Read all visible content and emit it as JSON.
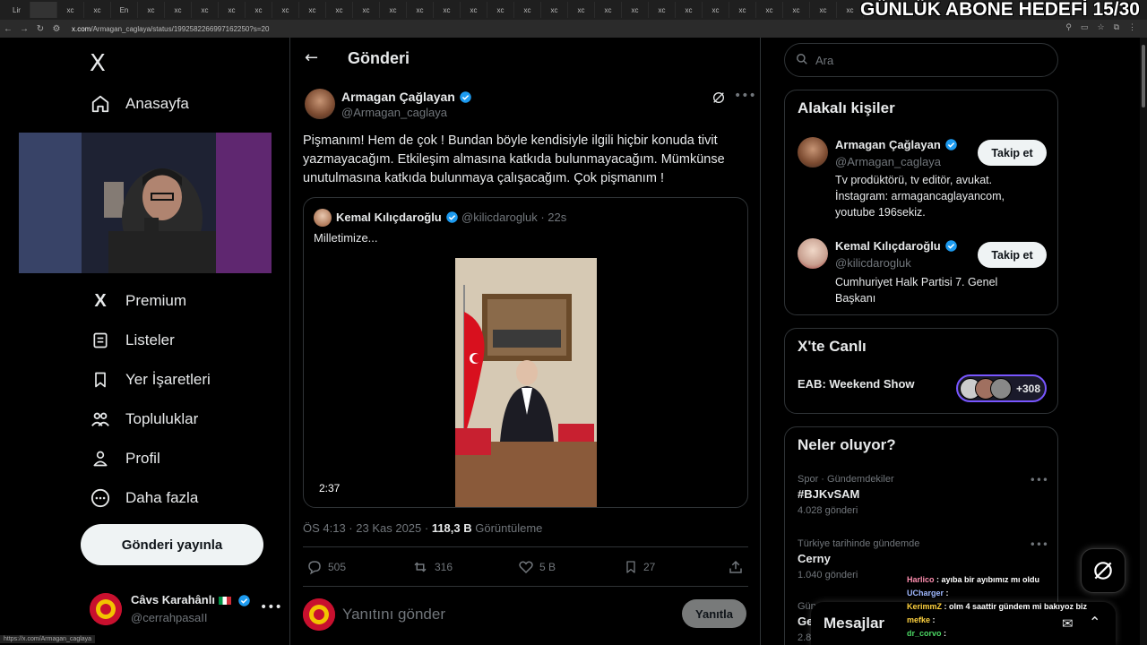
{
  "overlay": {
    "goal": "GÜNLÜK ABONE HEDEFİ 15/30"
  },
  "browser": {
    "tabs": [
      "Lir",
      "",
      "xc",
      "xc",
      "En",
      "xc",
      "xc",
      "xc",
      "xc",
      "xc",
      "xc",
      "xc",
      "xc",
      "xc",
      "xc",
      "xc",
      "xc",
      "xc",
      "xc",
      "xc",
      "xc",
      "xc",
      "xc",
      "xc",
      "xc",
      "xc",
      "xc",
      "xc",
      "xc",
      "xc",
      "xc",
      "xc"
    ],
    "url_host": "x.com",
    "url_path": "/Armagan_caglaya/status/1992582266997162250?s=20",
    "status_url": "https://x.com/Armagan_caglaya"
  },
  "sidebar": {
    "logo": "X",
    "items": [
      {
        "label": "Anasayfa",
        "icon": "home-icon"
      },
      {
        "label": "Premium",
        "icon": "x-premium-icon"
      },
      {
        "label": "Listeler",
        "icon": "list-icon"
      },
      {
        "label": "Yer İşaretleri",
        "icon": "bookmark-icon"
      },
      {
        "label": "Topluluklar",
        "icon": "communities-icon"
      },
      {
        "label": "Profil",
        "icon": "profile-icon"
      },
      {
        "label": "Daha fazla",
        "icon": "more-circle-icon"
      }
    ],
    "post_button": "Gönderi yayınla",
    "account": {
      "name": "Câvs Karahânlı",
      "handle": "@cerrahpasaII"
    }
  },
  "main": {
    "header_title": "Gönderi",
    "tweet": {
      "author": "Armagan Çağlayan",
      "handle": "@Armagan_caglaya",
      "text": "Pişmanım! Hem de çok ! Bundan böyle kendisiyle ilgili hiçbir konuda tivit yazmayacağım. Etkileşim almasına katkıda bulunmayacağım. Mümkünse unutulmasına katkıda bulunmaya çalışacağım. Çok pişmanım !",
      "quote": {
        "author": "Kemal Kılıçdaroğlu",
        "handle": "@kilicdarogluk",
        "time": "· 22s",
        "text": "Milletimize...",
        "video_duration": "2:37"
      },
      "time": "ÖS 4:13 · 23 Kas 2025 · ",
      "views_count": "118,3 B",
      "views_label": "Görüntüleme",
      "replies": "505",
      "reposts": "316",
      "likes": "5 B",
      "bookmarks": "27"
    },
    "reply_placeholder": "Yanıtını gönder",
    "reply_button": "Yanıtla"
  },
  "right": {
    "search_placeholder": "Ara",
    "related": {
      "title": "Alakalı kişiler",
      "people": [
        {
          "name": "Armagan Çağlayan",
          "handle": "@Armagan_caglaya",
          "bio": "Tv prodüktörü, tv editör, avukat. İnstagram: armagancaglayancom, youtube 196sekiz.",
          "follow": "Takip et"
        },
        {
          "name": "Kemal Kılıçdaroğlu",
          "handle": "@kilicdarogluk",
          "bio": "Cumhuriyet Halk Partisi 7. Genel Başkanı",
          "follow": "Takip et"
        }
      ]
    },
    "live": {
      "title": "X'te Canlı",
      "show": "EAB: Weekend Show",
      "count": "+308"
    },
    "trends": {
      "title": "Neler oluyor?",
      "items": [
        {
          "category": "Spor · Gündemdekiler",
          "name": "#BJKvSAM",
          "count": "4.028 gönderi"
        },
        {
          "category": "Türkiye tarihinde gündemde",
          "name": "Cerny",
          "count": "1.040 gönderi"
        },
        {
          "category": "Gün",
          "name": "Ge",
          "count": "2.8"
        }
      ]
    },
    "messages_title": "Mesajlar"
  },
  "chat": [
    {
      "user": "Harlico",
      "user_color": "#ff8fb0",
      "text": " : ayıba bir ayıbımız mı oldu"
    },
    {
      "user": "UCharger",
      "user_color": "#9fb8ff",
      "text": " : "
    },
    {
      "user": "KerimmZ",
      "user_color": "#ffd23f",
      "text": " : olm 4 saattir gündem mi bakıyoz biz"
    },
    {
      "user": "mefke",
      "user_color": "#ffd23f",
      "text": " : "
    },
    {
      "user": "dr_corvo",
      "user_color": "#4cd964",
      "text": " : "
    }
  ],
  "colors": {
    "accent": "#1d9bf0",
    "bg": "#000000",
    "border": "#2f3336",
    "muted": "#71767b"
  }
}
